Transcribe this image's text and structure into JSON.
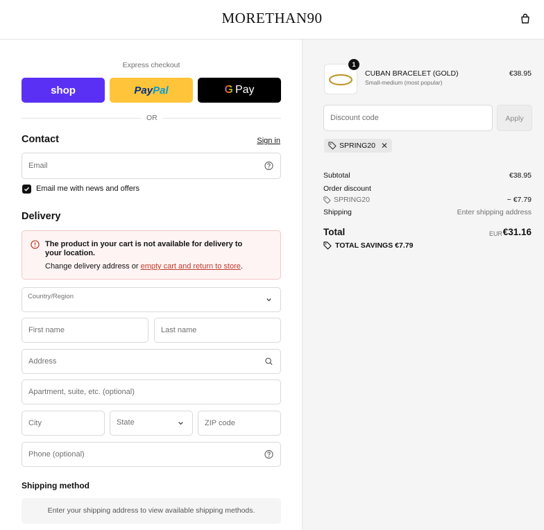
{
  "header": {
    "brand": "MORETHAN90"
  },
  "express": {
    "label": "Express checkout",
    "shop_label": "shop",
    "paypal_part1": "Pay",
    "paypal_part2": "Pal",
    "gpay_g": "G",
    "gpay_label": "Pay",
    "or_text": "OR"
  },
  "contact": {
    "title": "Contact",
    "sign_in": "Sign in",
    "email_placeholder": "Email",
    "news_label": "Email me with news and offers",
    "news_checked": true
  },
  "delivery": {
    "title": "Delivery",
    "alert_title": "The product in your cart is not available for delivery to your location.",
    "alert_body_prefix": "Change delivery address or ",
    "alert_link": "empty cart and return to store",
    "alert_body_suffix": ".",
    "country_label": "Country/Region",
    "first_name": "First name",
    "last_name": "Last name",
    "address": "Address",
    "apartment": "Apartment, suite, etc. (optional)",
    "city": "City",
    "state": "State",
    "zip": "ZIP code",
    "phone": "Phone (optional)"
  },
  "shipping": {
    "title": "Shipping method",
    "message": "Enter your shipping address to view available shipping methods."
  },
  "summary": {
    "product": {
      "quantity": "1",
      "name": "CUBAN BRACELET (GOLD)",
      "variant": "Small-medium (most popular)",
      "price": "€38.95"
    },
    "discount_placeholder": "Discount code",
    "apply_label": "Apply",
    "code": "SPRING20",
    "subtotal_label": "Subtotal",
    "subtotal_value": "€38.95",
    "order_discount_label": "Order discount",
    "discount_code": "SPRING20",
    "discount_value": "− €7.79",
    "shipping_label": "Shipping",
    "shipping_value": "Enter shipping address",
    "total_label": "Total",
    "total_currency": "EUR",
    "total_value": "€31.16",
    "savings_label": "TOTAL SAVINGS €7.79"
  }
}
